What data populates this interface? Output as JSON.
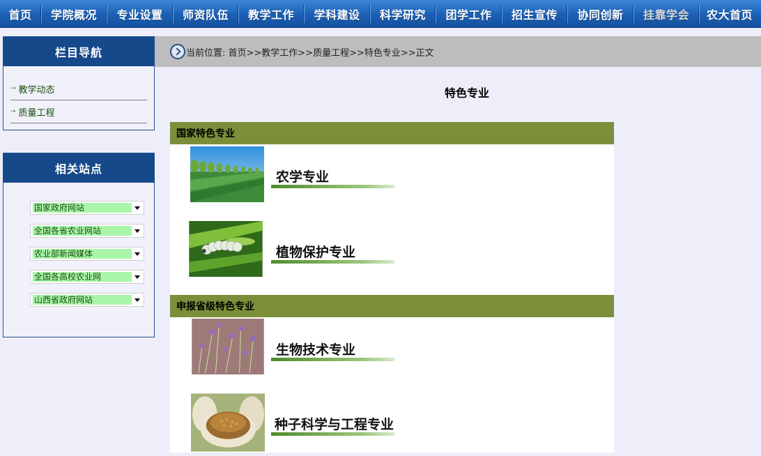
{
  "topnav": {
    "items": [
      "首页",
      "学院概况",
      "专业设置",
      "师资队伍",
      "教学工作",
      "学科建设",
      "科学研究",
      "团学工作",
      "招生宣传",
      "协同创新",
      "挂靠学会",
      "农大首页"
    ]
  },
  "sidebar": {
    "nav_title": "栏目导航",
    "nav_items": [
      "教学动态",
      "质量工程"
    ],
    "sites_title": "相关站点",
    "sites": [
      "国家政府网站",
      "全国各省农业网站",
      "农业部新闻媒体",
      "全国各高校农业网",
      "山西省政府网站"
    ]
  },
  "breadcrumb": {
    "text": "当前位置: 首页>>教学工作>>质量工程>>特色专业>>正文"
  },
  "page": {
    "title": "特色专业"
  },
  "sections": [
    {
      "title": "国家特色专业",
      "majors": [
        "农学专业",
        "植物保护专业"
      ]
    },
    {
      "title": "申报省级特色专业",
      "majors": [
        "生物技术专业",
        "种子科学与工程专业"
      ]
    }
  ],
  "colors": {
    "nav_blue": "#1b5fb5",
    "side_header": "#16498a",
    "section_green": "#7b8f3a",
    "select_fill": "#a9f5a9",
    "page_bg": "#eeeefa"
  }
}
